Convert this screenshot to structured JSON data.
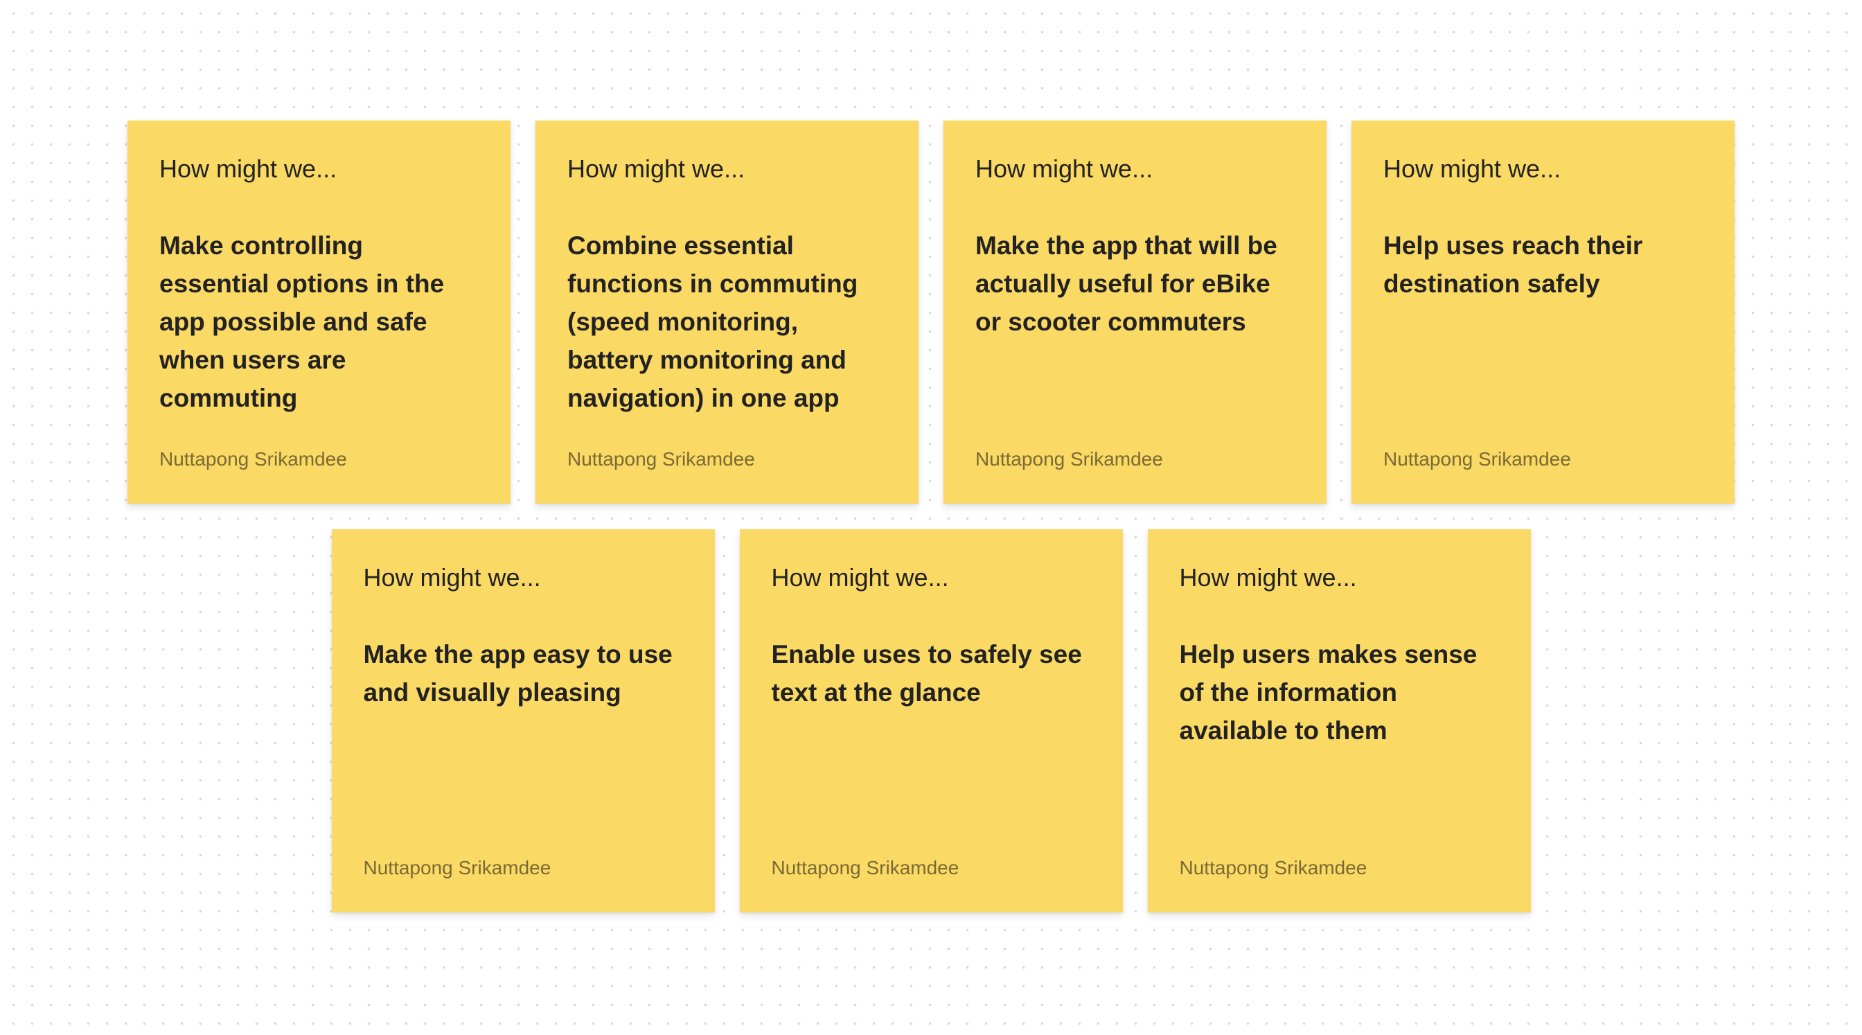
{
  "notes": [
    {
      "prompt": "How might we...",
      "text": "Make controlling essential options in the app possible and safe when users are commuting",
      "author": "Nuttapong Srikamdee"
    },
    {
      "prompt": "How might we...",
      "text": "Combine essential functions in commuting (speed monitoring, battery monitoring and navigation) in one app",
      "author": "Nuttapong Srikamdee"
    },
    {
      "prompt": "How might we...",
      "text": "Make the app that will be actually useful for eBike or scooter commuters",
      "author": "Nuttapong Srikamdee"
    },
    {
      "prompt": "How might we...",
      "text": "Help uses reach their destination safely",
      "author": "Nuttapong Srikamdee"
    },
    {
      "prompt": "How might we...",
      "text": "Make the app easy to use and visually pleasing",
      "author": "Nuttapong Srikamdee"
    },
    {
      "prompt": "How might we...",
      "text": "Enable uses to safely see text at the glance",
      "author": "Nuttapong Srikamdee"
    },
    {
      "prompt": "How might we...",
      "text": "Help users makes sense of the information available to them",
      "author": "Nuttapong Srikamdee"
    }
  ],
  "colors": {
    "sticky": "#fbd965",
    "canvas": "#ffffff",
    "dot": "#d9d9d9"
  }
}
